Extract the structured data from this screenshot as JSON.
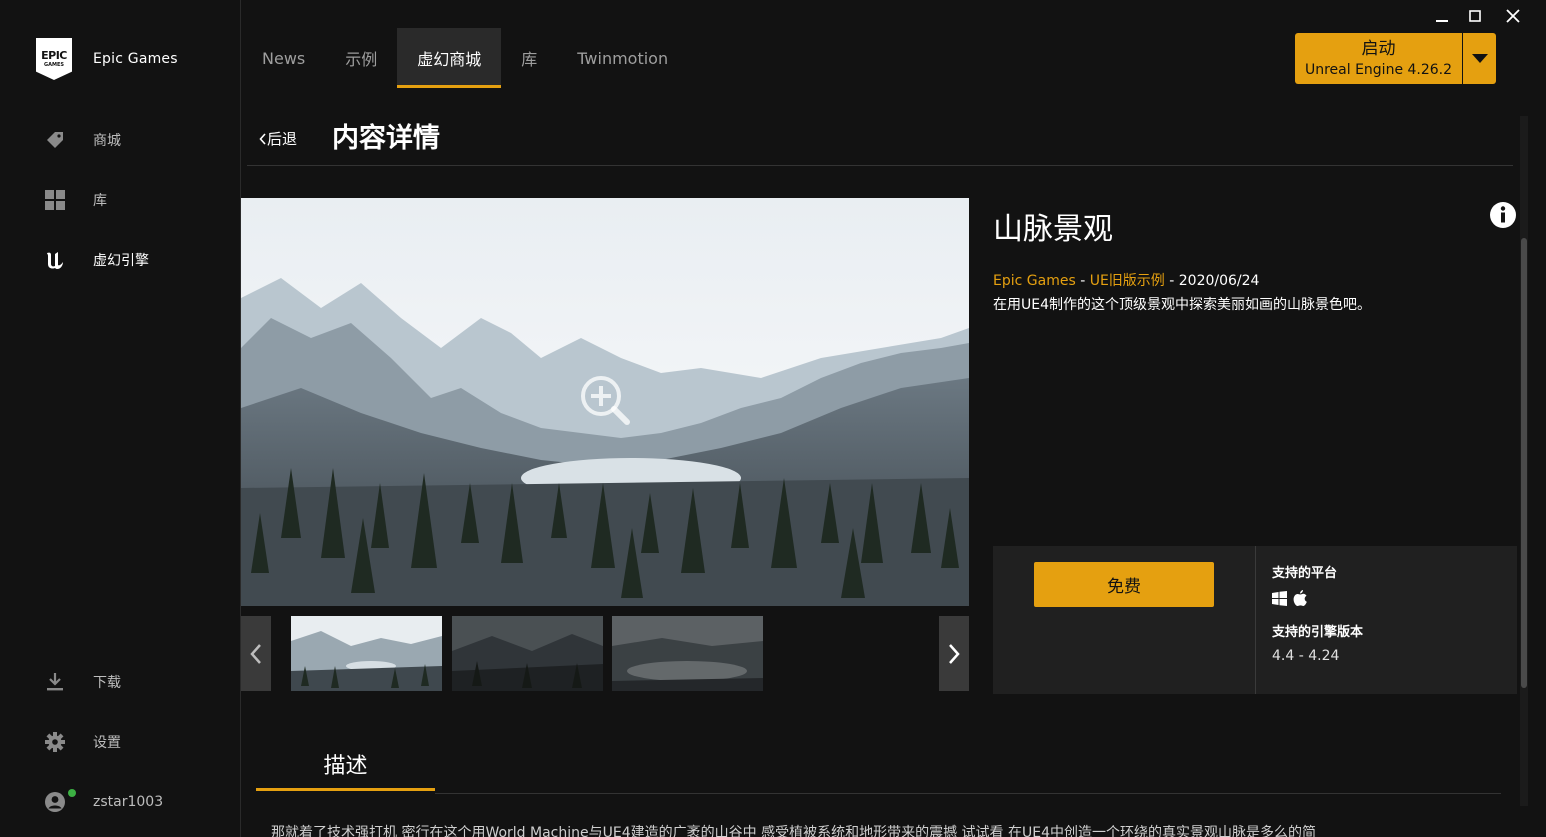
{
  "sidebar": {
    "brand": {
      "logo_top": "EPIC",
      "logo_bottom": "GAMES",
      "name": "Epic Games"
    },
    "nav": [
      {
        "label": "商城",
        "icon": "tag-icon"
      },
      {
        "label": "库",
        "icon": "grid-icon"
      },
      {
        "label": "虚幻引擎",
        "icon": "unreal-icon",
        "active": true
      }
    ],
    "bottom": [
      {
        "label": "下载",
        "icon": "download-icon"
      },
      {
        "label": "设置",
        "icon": "gear-icon"
      },
      {
        "label": "zstar1003",
        "icon": "user-icon",
        "status": "online"
      }
    ]
  },
  "topbar": {
    "tabs": [
      "News",
      "示例",
      "虚幻商城",
      "库",
      "Twinmotion"
    ],
    "active_tab": "虚幻商城",
    "launch": {
      "title": "启动",
      "subtitle": "Unreal Engine 4.26.2"
    }
  },
  "page": {
    "back_label": "后退",
    "title": "内容详情"
  },
  "product": {
    "name": "山脉景观",
    "publisher": "Epic Games",
    "category": "UE旧版示例",
    "date": "2020/06/24",
    "tagline": "在用UE4制作的这个顶级景观中探索美丽如画的山脉景色吧。",
    "price_label": "免费",
    "platforms_label": "支持的平台",
    "platforms": [
      "windows-icon",
      "apple-icon"
    ],
    "engine_label": "支持的引擎版本",
    "engine_versions": "4.4 - 4.24"
  },
  "description": {
    "tab_label": "描述",
    "text": "那就着了技术强打机 密行在这个用World Machine与UE4建造的广袤的山谷中 感受植被系统和地形带来的震撼 试试看 在UE4中创造一个环绕的真实景观山脉是多么的简"
  },
  "colors": {
    "accent": "#e5a010",
    "background": "#121212",
    "panel": "#202020",
    "active_tab": "#2a2a2a"
  }
}
